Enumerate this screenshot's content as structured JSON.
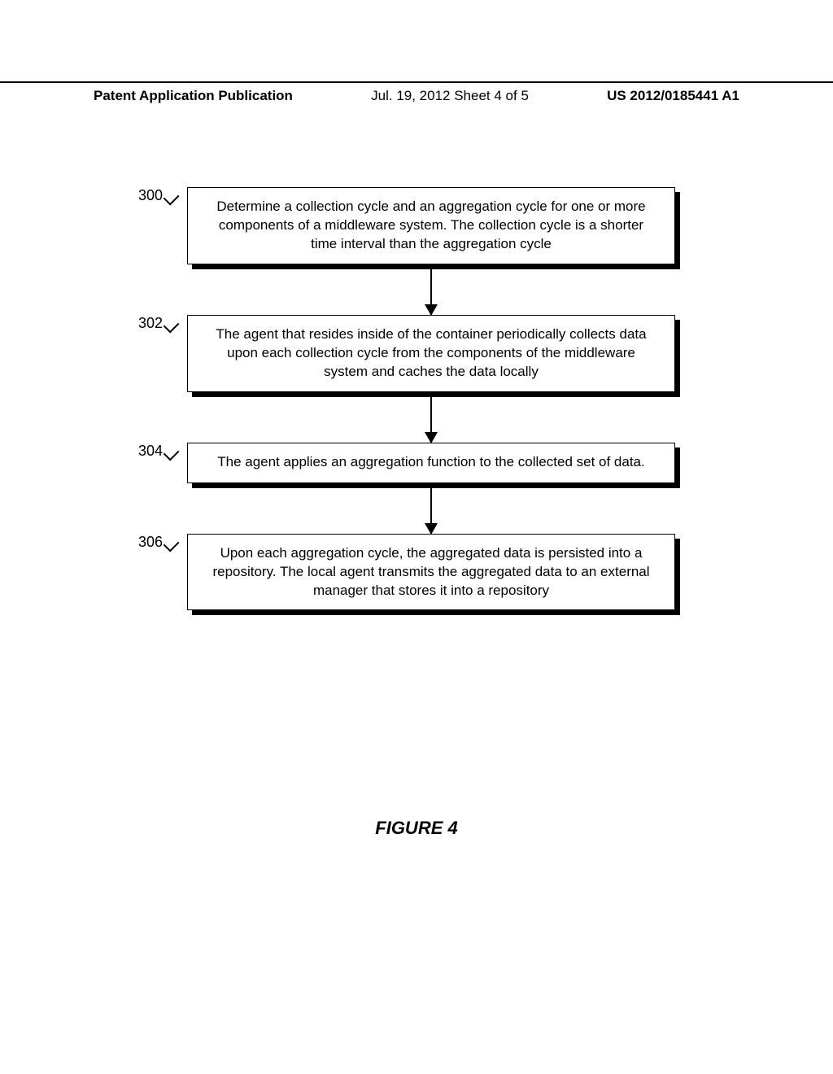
{
  "header": {
    "left": "Patent Application Publication",
    "middle": "Jul. 19, 2012  Sheet 4 of 5",
    "right": "US 2012/0185441 A1"
  },
  "steps": [
    {
      "label": "300",
      "text": "Determine a collection cycle and an aggregation cycle for one or more components of a middleware system. The collection cycle is a shorter time interval than the aggregation cycle"
    },
    {
      "label": "302",
      "text": "The agent that resides inside of the container periodically collects data upon each collection cycle from the components of the middleware system and caches the data locally"
    },
    {
      "label": "304",
      "text": "The agent applies an aggregation function to the collected set of data."
    },
    {
      "label": "306",
      "text": "Upon each aggregation cycle, the aggregated data is persisted into a repository. The local agent transmits the aggregated data to an external manager that stores it into a repository"
    }
  ],
  "caption": "FIGURE 4"
}
